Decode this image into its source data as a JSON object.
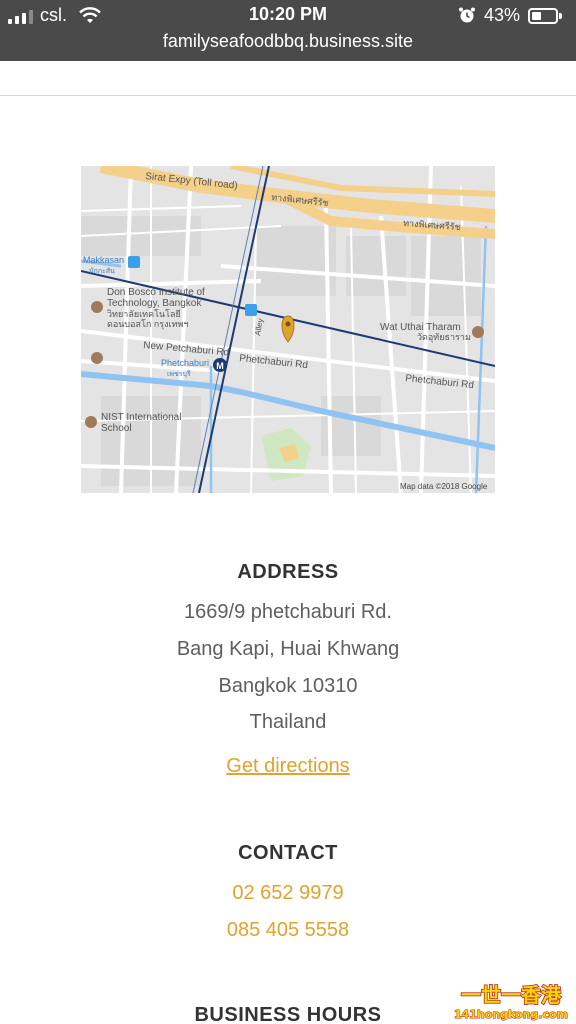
{
  "status_bar": {
    "carrier": "csl.",
    "time": "10:20 PM",
    "battery": "43%",
    "battery_level": 0.43,
    "icons": [
      "signal-icon",
      "wifi-icon",
      "alarm-icon",
      "battery-icon"
    ]
  },
  "browser": {
    "url": "familyseafoodbbq.business.site"
  },
  "map": {
    "labels": {
      "sirat_expy": "Sirat Expy (Toll road)",
      "thai_expy_1": "ทางพิเศษศรีรัช",
      "thai_expy_2": "ทางพิเศษศรีรัช",
      "makkasan": "Makkasan",
      "makkasan_thai": "มักกะสัน",
      "don_bosco_1": "Don Bosco Institute of",
      "don_bosco_2": "Technology, Bangkok",
      "don_bosco_3": "วิทยาลัยเทคโนโลยี",
      "don_bosco_4": "ดอนบอสโก กรุงเทพฯ",
      "alley": "Alley",
      "new_petchaburi": "New Petchaburi Rd",
      "phetchaburi_station": "Phetchaburi",
      "phetchaburi_station_thai": "เพชรบุรี",
      "phetchaburi_rd_1": "Phetchaburi Rd",
      "phetchaburi_rd_2": "Phetchaburi Rd",
      "wat_uthai_1": "Wat Uthai Tharam",
      "wat_uthai_2": "วัดอุทัยธาราม",
      "nist_1": "NIST International",
      "nist_2": "School",
      "attribution": "Map data ©2018 Google"
    },
    "colors": {
      "expressway": "#f4d08a",
      "water": "#8fc3f2",
      "rail": "#1d3b73",
      "pin": "#e0a32e"
    }
  },
  "address": {
    "heading": "ADDRESS",
    "line1": "1669/9 phetchaburi Rd.",
    "line2": "Bang Kapi, Huai Khwang",
    "line3": "Bangkok 10310",
    "line4": "Thailand",
    "directions_label": "Get directions"
  },
  "contact": {
    "heading": "CONTACT",
    "phone1": "02 652 9979",
    "phone2": "085 405 5558"
  },
  "hours": {
    "heading": "BUSINESS HOURS"
  },
  "watermark": {
    "chinese": "一世一香港",
    "site": "141hongkong.com"
  },
  "accent_color": "#e0a32e"
}
